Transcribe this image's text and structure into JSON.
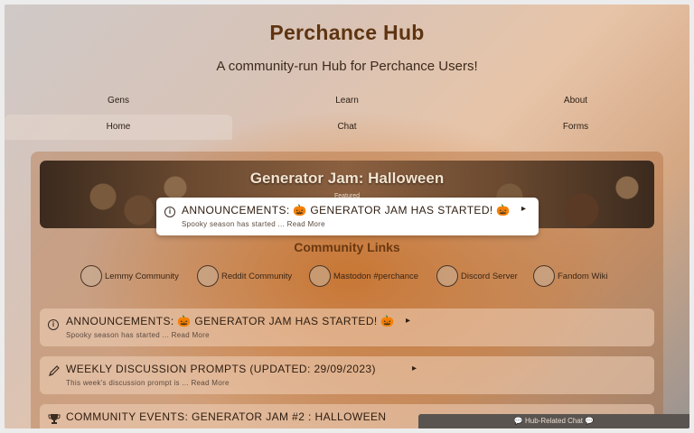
{
  "site": {
    "title": "Perchance Hub",
    "subtitle": "A community-run Hub for Perchance Users!"
  },
  "nav": {
    "row1": [
      {
        "label": "Gens"
      },
      {
        "label": "Learn"
      },
      {
        "label": "About"
      }
    ],
    "row2": [
      {
        "label": "Home",
        "active": true
      },
      {
        "label": "Chat"
      },
      {
        "label": "Forms"
      }
    ]
  },
  "banner": {
    "title": "Generator Jam: Halloween",
    "subtitle": "Featured"
  },
  "popup": {
    "icon": "info-icon",
    "heading": "ANNOUNCEMENTS: 🎃 GENERATOR JAM HAS STARTED! 🎃",
    "excerpt": "Spooky season has started ... Read More",
    "arrow": "▸"
  },
  "community": {
    "title": "Community Links",
    "links": [
      {
        "label": "Lemmy Community"
      },
      {
        "label": "Reddit Community"
      },
      {
        "label": "Mastodon #perchance"
      },
      {
        "label": "Discord Server"
      },
      {
        "label": "Fandom Wiki"
      }
    ]
  },
  "posts": [
    {
      "icon": "info-icon",
      "heading": "ANNOUNCEMENTS: 🎃 GENERATOR JAM HAS STARTED! 🎃",
      "excerpt": "Spooky season has started ... Read More",
      "arrow": "▸"
    },
    {
      "icon": "pencil-icon",
      "heading": "WEEKLY DISCUSSION PROMPTS (UPDATED: 29/09/2023)",
      "excerpt": "This week's discussion prompt is ... Read More",
      "arrow": "▸"
    },
    {
      "icon": "trophy-icon",
      "heading": "COMMUNITY EVENTS: GENERATOR JAM #2 : HALLOWEEN",
      "excerpt": "",
      "arrow": ""
    }
  ],
  "chat_bar": {
    "label": "💬 Hub-Related Chat 💬"
  },
  "colors": {
    "accent": "#6a3810",
    "title": "#5e3411",
    "card": "#f0d2b9",
    "chat_bar": "#5a5450"
  }
}
